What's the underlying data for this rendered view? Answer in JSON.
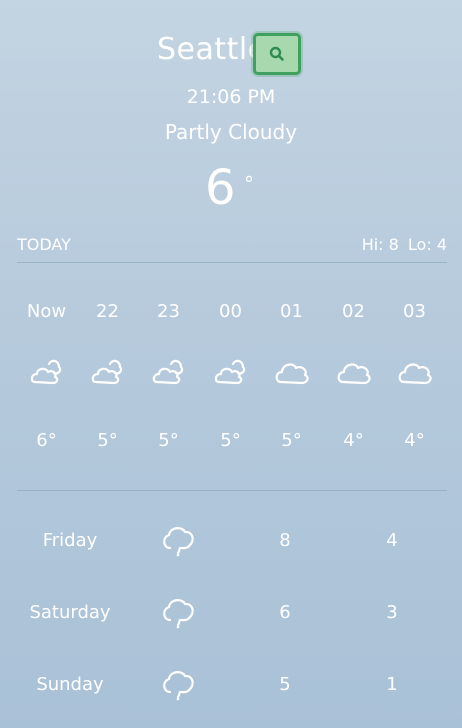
{
  "location": {
    "city": "Seattle",
    "time": "21:06 PM",
    "condition": "Partly Cloudy",
    "temperature": "6",
    "degree_symbol": "°"
  },
  "today": {
    "label": "TODAY",
    "hi": "Hi: 8",
    "lo": "Lo: 4"
  },
  "hourly": [
    {
      "label": "Now",
      "temp": "6°",
      "icon": "partly-cloudy-night-icon"
    },
    {
      "label": "22",
      "temp": "5°",
      "icon": "partly-cloudy-night-icon"
    },
    {
      "label": "23",
      "temp": "5°",
      "icon": "partly-cloudy-night-icon"
    },
    {
      "label": "00",
      "temp": "5°",
      "icon": "partly-cloudy-night-icon"
    },
    {
      "label": "01",
      "temp": "5°",
      "icon": "cloudy-icon"
    },
    {
      "label": "02",
      "temp": "4°",
      "icon": "cloudy-icon"
    },
    {
      "label": "03",
      "temp": "4°",
      "icon": "cloudy-icon"
    }
  ],
  "daily": [
    {
      "day": "Friday",
      "hi": "8",
      "lo": "4",
      "icon": "cloud-icon"
    },
    {
      "day": "Saturday",
      "hi": "6",
      "lo": "3",
      "icon": "cloud-icon"
    },
    {
      "day": "Sunday",
      "hi": "5",
      "lo": "1",
      "icon": "cloud-icon"
    }
  ],
  "colors": {
    "background_top": "#c3d4e2",
    "background_bottom": "#a9c1d7",
    "search_border": "#3fa060",
    "search_fill": "#a8d8ad",
    "text": "#ffffff"
  },
  "icons": {
    "search": "search-icon"
  }
}
